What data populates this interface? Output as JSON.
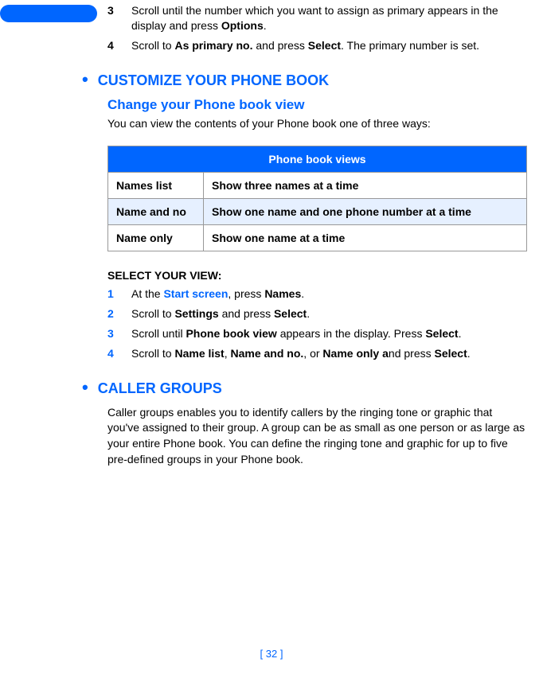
{
  "steps_top": [
    {
      "num": "3",
      "text_before": "Scroll until the number which you want to assign as primary appears in the display and press ",
      "bold1": "Options",
      "text_after": "."
    },
    {
      "num": "4",
      "text_before": "Scroll to ",
      "bold1": "As primary no.",
      "text_mid": " and press ",
      "bold2": "Select",
      "text_after": ". The primary number is set."
    }
  ],
  "heading1": "CUSTOMIZE YOUR PHONE BOOK",
  "subheading1": "Change your Phone book view",
  "intro1": "You can view the contents of your Phone book one of three ways:",
  "table": {
    "header": "Phone book views",
    "rows": [
      {
        "label": "Names list",
        "desc": "Show three names at a time"
      },
      {
        "label": "Name and no",
        "desc": "Show one name and one phone number at a time"
      },
      {
        "label": "Name only",
        "desc": "Show one name at a time"
      }
    ]
  },
  "select_heading": "SELECT YOUR VIEW:",
  "select_steps": {
    "s1": {
      "num": "1",
      "pre": "At the ",
      "link": "Start screen",
      "mid": ", press ",
      "b1": "Names",
      "post": "."
    },
    "s2": {
      "num": "2",
      "pre": "Scroll to ",
      "b1": "Settings",
      "mid": " and press ",
      "b2": "Select",
      "post": "."
    },
    "s3": {
      "num": "3",
      "pre": "Scroll until ",
      "b1": "Phone book view",
      "mid": " appears in the display. Press ",
      "b2": "Select",
      "post": "."
    },
    "s4": {
      "num": "4",
      "pre": "Scroll to ",
      "b1": "Name list",
      "c1": ", ",
      "b2": "Name and no.",
      "c2": ", or ",
      "b3": "Name only a",
      "mid": "nd press ",
      "b4": "Select",
      "post": "."
    }
  },
  "heading2": "CALLER GROUPS",
  "caller_para": "Caller groups enables you to identify callers by the ringing tone or graphic that you've assigned to their group. A group can be as small as one person or as large as your entire Phone book. You can define the ringing tone and graphic for up to five pre-defined groups in your Phone book.",
  "page_number": "[ 32 ]"
}
